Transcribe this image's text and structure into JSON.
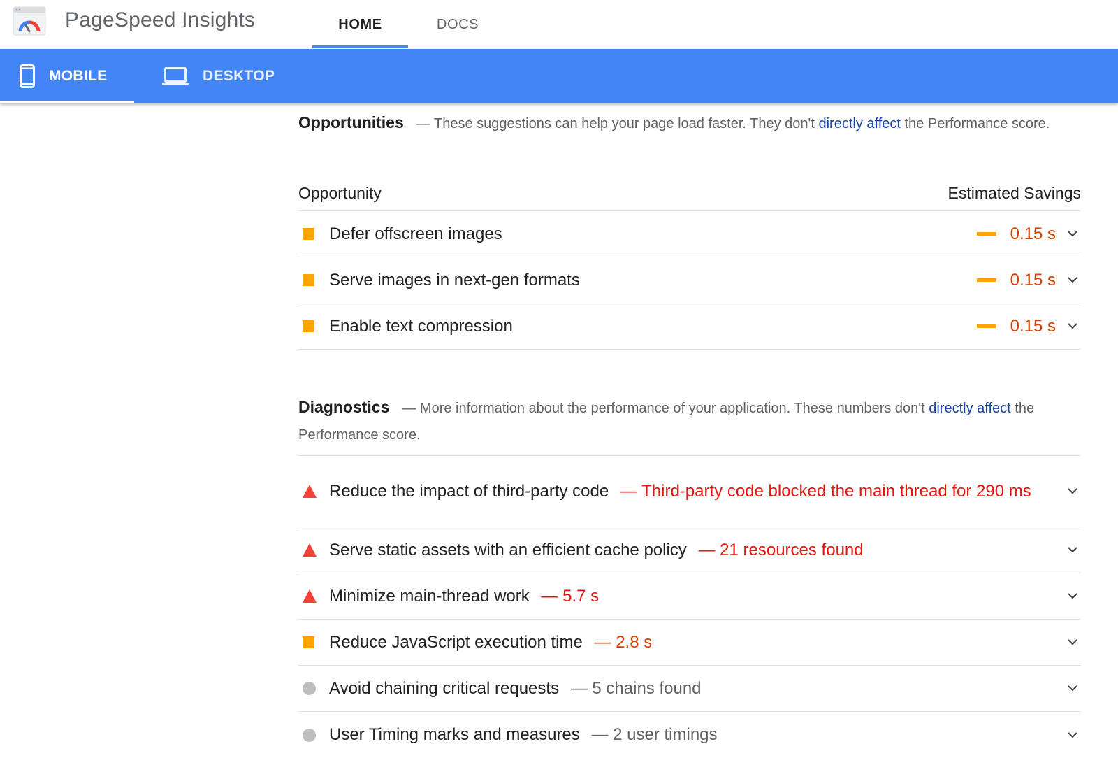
{
  "header": {
    "app_title": "PageSpeed Insights",
    "nav_tabs": [
      {
        "label": "HOME",
        "active": true
      },
      {
        "label": "DOCS",
        "active": false
      }
    ]
  },
  "device_tabs": [
    {
      "label": "MOBILE",
      "icon": "smartphone-icon",
      "active": true
    },
    {
      "label": "DESKTOP",
      "icon": "laptop-icon",
      "active": false
    }
  ],
  "opportunities": {
    "title": "Opportunities",
    "desc_before": "— These suggestions can help your page load faster. They don't ",
    "desc_link": "directly affect",
    "desc_after": " the Performance score.",
    "col_opportunity": "Opportunity",
    "col_savings": "Estimated Savings",
    "items": [
      {
        "label": "Defer offscreen images",
        "savings": "0.15 s",
        "severity": "average"
      },
      {
        "label": "Serve images in next-gen formats",
        "savings": "0.15 s",
        "severity": "average"
      },
      {
        "label": "Enable text compression",
        "savings": "0.15 s",
        "severity": "average"
      }
    ]
  },
  "diagnostics": {
    "title": "Diagnostics",
    "desc_before": "— More information about the performance of your application. These numbers don't ",
    "desc_link": "directly affect",
    "desc_after": " the Performance score.",
    "items": [
      {
        "label": "Reduce the impact of third-party code",
        "detail": "— Third-party code blocked the main thread for 290 ms",
        "severity": "fail"
      },
      {
        "label": "Serve static assets with an efficient cache policy",
        "detail": "— 21 resources found",
        "severity": "fail"
      },
      {
        "label": "Minimize main-thread work",
        "detail": "— 5.7 s",
        "severity": "fail"
      },
      {
        "label": "Reduce JavaScript execution time",
        "detail": "— 2.8 s",
        "severity": "average"
      },
      {
        "label": "Avoid chaining critical requests",
        "detail": "— 5 chains found",
        "severity": "info"
      },
      {
        "label": "User Timing marks and measures",
        "detail": "— 2 user timings",
        "severity": "info"
      }
    ]
  },
  "colors": {
    "brand_blue": "#4285f4",
    "link_blue": "#1a44a6",
    "fail_red": "#f44336",
    "average_orange": "#ffa400",
    "info_gray": "#bdbdbd"
  }
}
